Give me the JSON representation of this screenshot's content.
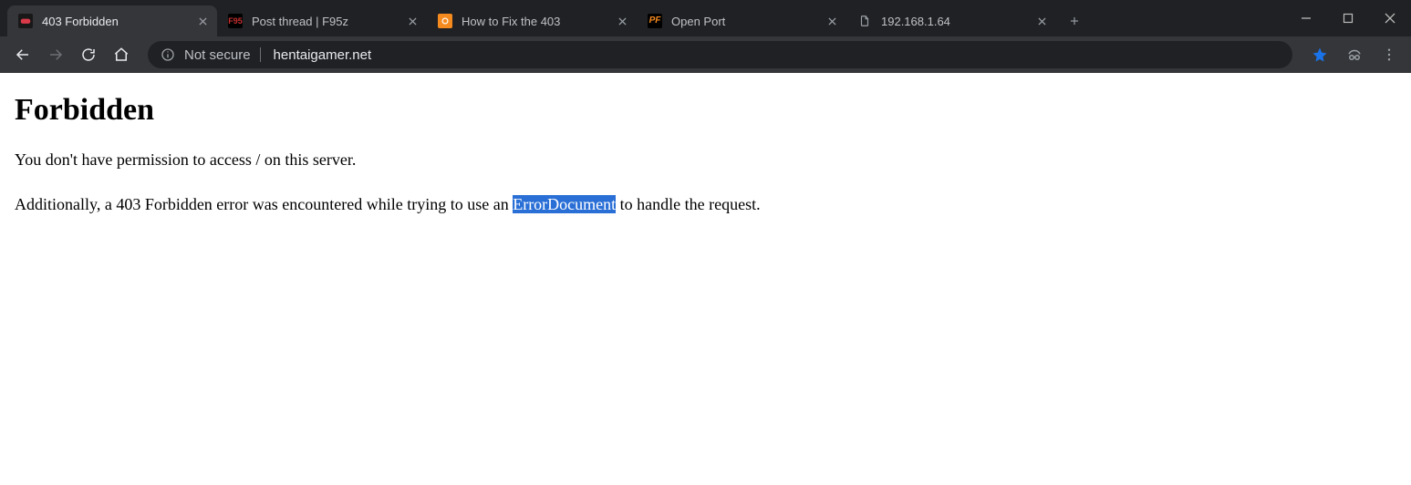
{
  "tabs": [
    {
      "title": "403 Forbidden",
      "favicon_bg": "#181818",
      "favicon_fg": "#d93a4a",
      "favicon_shape": "controller",
      "active": true
    },
    {
      "title": "Post thread | F95z",
      "favicon_bg": "#000",
      "favicon_fg": "#c62f2f",
      "favicon_shape": "f95",
      "active": false
    },
    {
      "title": "How to Fix the 403",
      "favicon_bg": "#f58a1f",
      "favicon_fg": "#fff",
      "favicon_shape": "circle",
      "active": false
    },
    {
      "title": "Open Port",
      "favicon_bg": "#000",
      "favicon_fg": "#f58a1f",
      "favicon_shape": "pf",
      "active": false
    },
    {
      "title": "192.168.1.64",
      "favicon_bg": "transparent",
      "favicon_fg": "#9aa0a6",
      "favicon_shape": "file",
      "active": false
    }
  ],
  "omnibox": {
    "not_secure_label": "Not secure",
    "url": "hentaigamer.net"
  },
  "page": {
    "heading": "Forbidden",
    "p1": "You don't have permission to access / on this server.",
    "p2a": "Additionally, a 403 Forbidden error was encountered while trying to use an ",
    "p2_highlight": "ErrorDocument",
    "p2b": " to handle the request."
  }
}
